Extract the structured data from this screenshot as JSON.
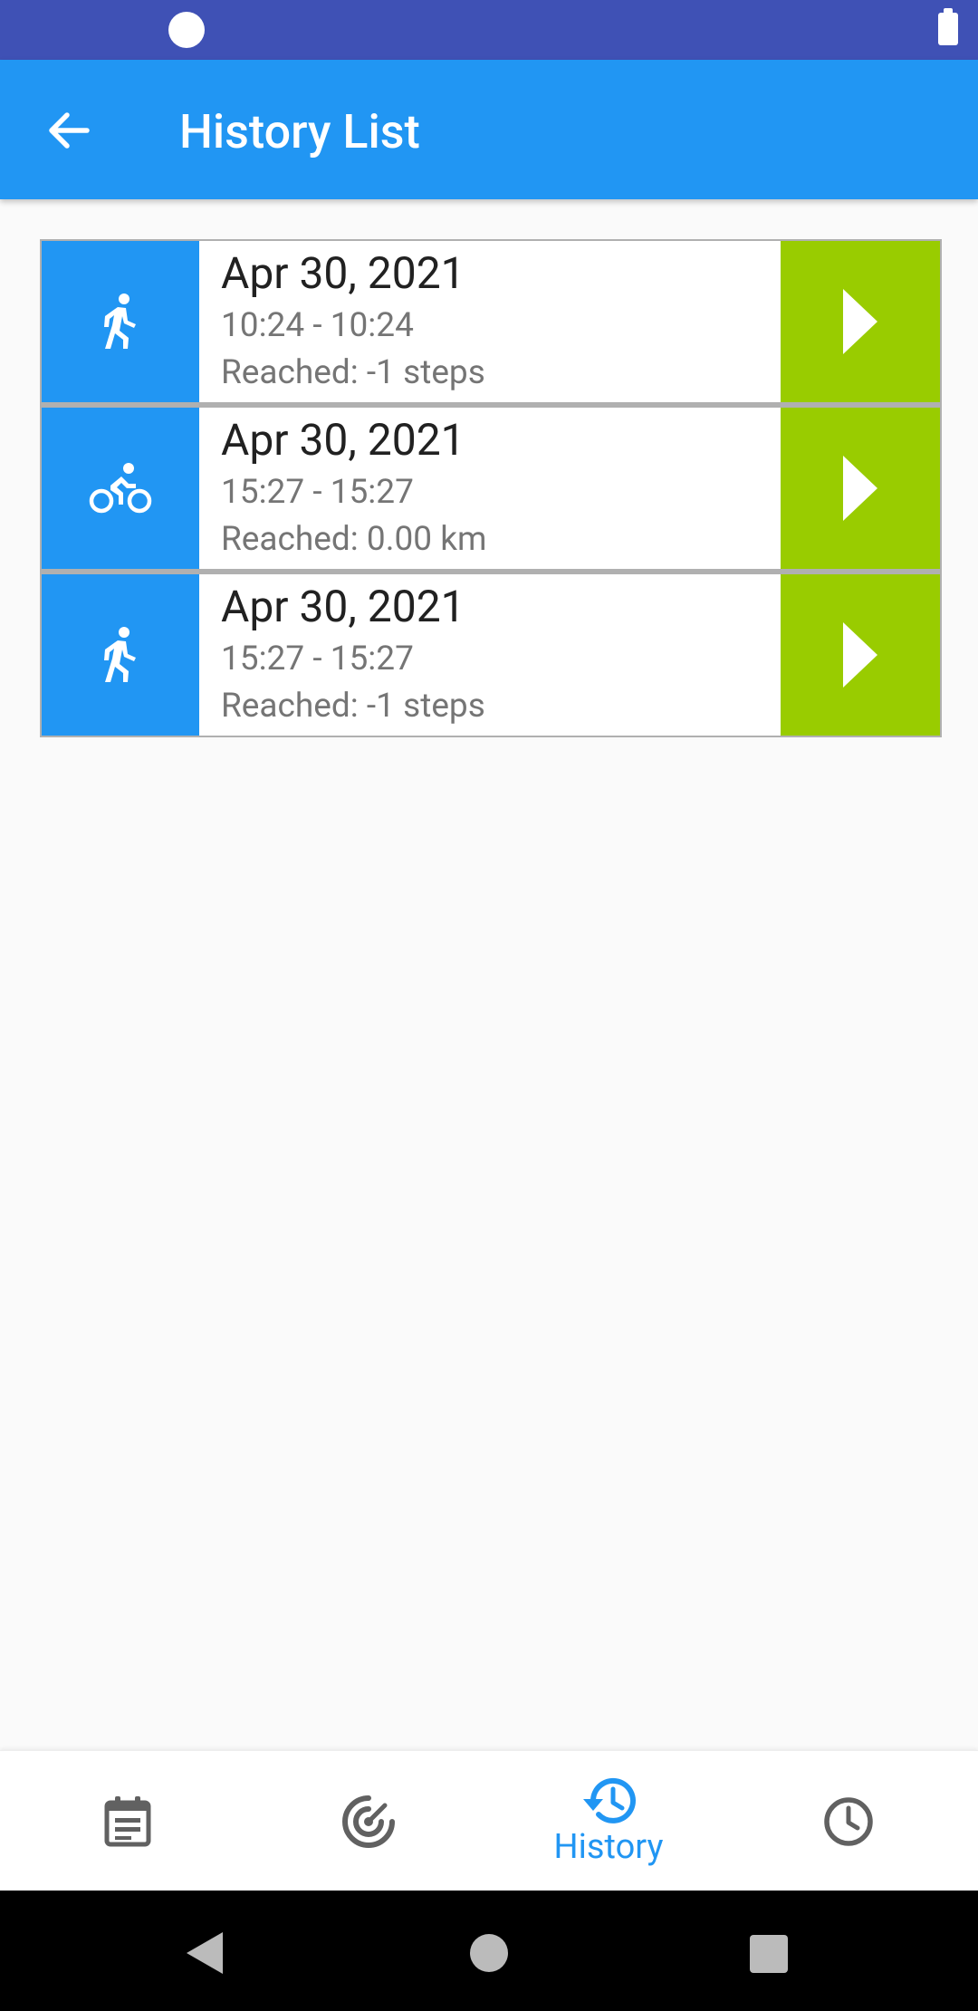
{
  "app_bar": {
    "title": "History List"
  },
  "history": [
    {
      "activity_icon": "walk-icon",
      "date": "Apr 30, 2021",
      "time_range": "10:24 - 10:24",
      "reached": "Reached: -1 steps"
    },
    {
      "activity_icon": "bike-icon",
      "date": "Apr 30, 2021",
      "time_range": "15:27 - 15:27",
      "reached": "Reached: 0.00 km"
    },
    {
      "activity_icon": "walk-icon",
      "date": "Apr 30, 2021",
      "time_range": "15:27 - 15:27",
      "reached": "Reached: -1 steps"
    }
  ],
  "bottom_nav": {
    "items": [
      {
        "icon": "calendar-list-icon",
        "label": ""
      },
      {
        "icon": "radar-icon",
        "label": ""
      },
      {
        "icon": "history-icon",
        "label": "History",
        "active": true
      },
      {
        "icon": "clock-icon",
        "label": ""
      }
    ]
  },
  "colors": {
    "status_bar": "#3f51b5",
    "primary": "#2196f3",
    "play_accent": "#99cc00",
    "nav_inactive": "#616161"
  }
}
